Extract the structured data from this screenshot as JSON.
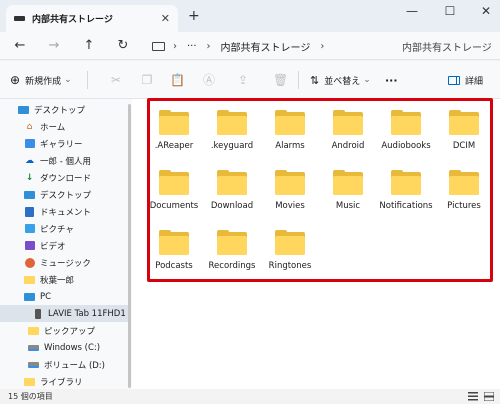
{
  "window": {
    "tab_title": "内部共有ストレージ",
    "new_tab_label": "+",
    "minimize_glyph": "—",
    "maximize_glyph": "☐",
    "close_glyph": "✕",
    "tab_close_glyph": "✕"
  },
  "nav": {
    "back_glyph": "←",
    "forward_glyph": "→",
    "up_glyph": "↑",
    "refresh_glyph": "↻",
    "breadcrumb_sep": "›",
    "breadcrumb_more": "···",
    "breadcrumb_current": "内部共有ストレージ",
    "breadcrumb_trailing": "›",
    "search_placeholder": "内部共有ストレージ"
  },
  "toolbar": {
    "new_label": "新規作成",
    "new_caret": "⌄",
    "sort_label": "並べ替え",
    "sort_caret": "⌄",
    "more_label": "···",
    "details_label": "詳細"
  },
  "sidebar": {
    "items": [
      {
        "label": "デスクトップ",
        "icon": "desktop-icon"
      },
      {
        "label": "ホーム",
        "icon": "home-icon"
      },
      {
        "label": "ギャラリー",
        "icon": "gallery-icon"
      },
      {
        "label": "一郎 - 個人用",
        "icon": "cloud-icon"
      },
      {
        "label": "ダウンロード",
        "icon": "download-icon"
      },
      {
        "label": "デスクトップ",
        "icon": "desktop-icon"
      },
      {
        "label": "ドキュメント",
        "icon": "document-icon"
      },
      {
        "label": "ピクチャ",
        "icon": "pictures-icon"
      },
      {
        "label": "ビデオ",
        "icon": "video-icon"
      },
      {
        "label": "ミュージック",
        "icon": "music-icon"
      },
      {
        "label": "秋葉一郎",
        "icon": "folder-icon"
      },
      {
        "label": "PC",
        "icon": "pc-icon"
      },
      {
        "label": "LAVIE Tab 11FHD1",
        "icon": "tablet-icon"
      },
      {
        "label": "ピックアップ",
        "icon": "folder-icon"
      },
      {
        "label": "Windows (C:)",
        "icon": "drive-c-icon"
      },
      {
        "label": "ボリューム (D:)",
        "icon": "drive-d-icon"
      },
      {
        "label": "ライブラリ",
        "icon": "library-icon"
      }
    ]
  },
  "folders": [
    ".AReaper",
    ".keyguard",
    "Alarms",
    "Android",
    "Audiobooks",
    "DCIM",
    "Documents",
    "Download",
    "Movies",
    "Music",
    "Notifications",
    "Pictures",
    "Podcasts",
    "Recordings",
    "Ringtones"
  ],
  "status": {
    "item_count": "15 個の項目"
  },
  "colors": {
    "highlight_border": "#d9000d",
    "folder_front": "#ffd75e",
    "folder_back": "#e9b93a",
    "accent": "#0067c0"
  }
}
